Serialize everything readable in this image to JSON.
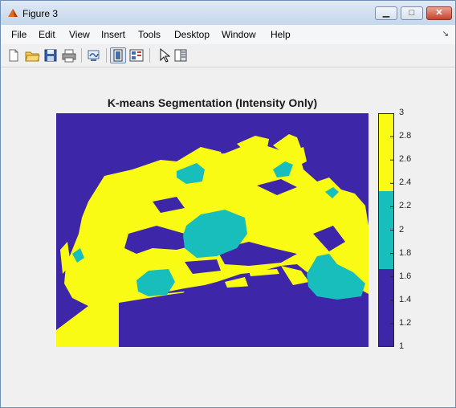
{
  "window": {
    "title": "Figure 3"
  },
  "titlebar_buttons": [
    {
      "name": "minimize",
      "glyph": "▁"
    },
    {
      "name": "maximize",
      "glyph": "□"
    },
    {
      "name": "close",
      "glyph": "✕"
    }
  ],
  "menubar": {
    "items": [
      "File",
      "Edit",
      "View",
      "Insert",
      "Tools",
      "Desktop",
      "Window",
      "Help"
    ],
    "dock_arrow": "↘"
  },
  "toolbar": {
    "icons": [
      "new-figure-icon",
      "open-file-icon",
      "save-icon",
      "print-icon",
      "link-plot-icon",
      "hide-plot-tools-icon",
      "show-plot-tools-icon",
      "edit-plot-pointer-icon",
      "property-editor-icon"
    ],
    "pressed": "hide-plot-tools-icon"
  },
  "plot": {
    "title": "K-means Segmentation (Intensity Only)"
  },
  "colors": {
    "cluster1": "#3e26a8",
    "cluster2": "#17bebb",
    "cluster3": "#f9fb15",
    "window_border": "#6d8fb5"
  },
  "chart_data": {
    "type": "heatmap",
    "title": "K-means Segmentation (Intensity Only)",
    "colorbar": {
      "min": 1,
      "max": 3,
      "ticks": [
        1,
        1.2,
        1.4,
        1.6,
        1.8,
        2,
        2.2,
        2.4,
        2.6,
        2.8,
        3
      ],
      "tick_labels": [
        "1",
        "1.2",
        "1.4",
        "1.6",
        "1.8",
        "2",
        "2.2",
        "2.4",
        "2.6",
        "2.8",
        "3"
      ],
      "levels": [
        {
          "value": 1,
          "color": "#3e26a8"
        },
        {
          "value": 2,
          "color": "#17bebb"
        },
        {
          "value": 3,
          "color": "#f9fb15"
        }
      ]
    }
  }
}
